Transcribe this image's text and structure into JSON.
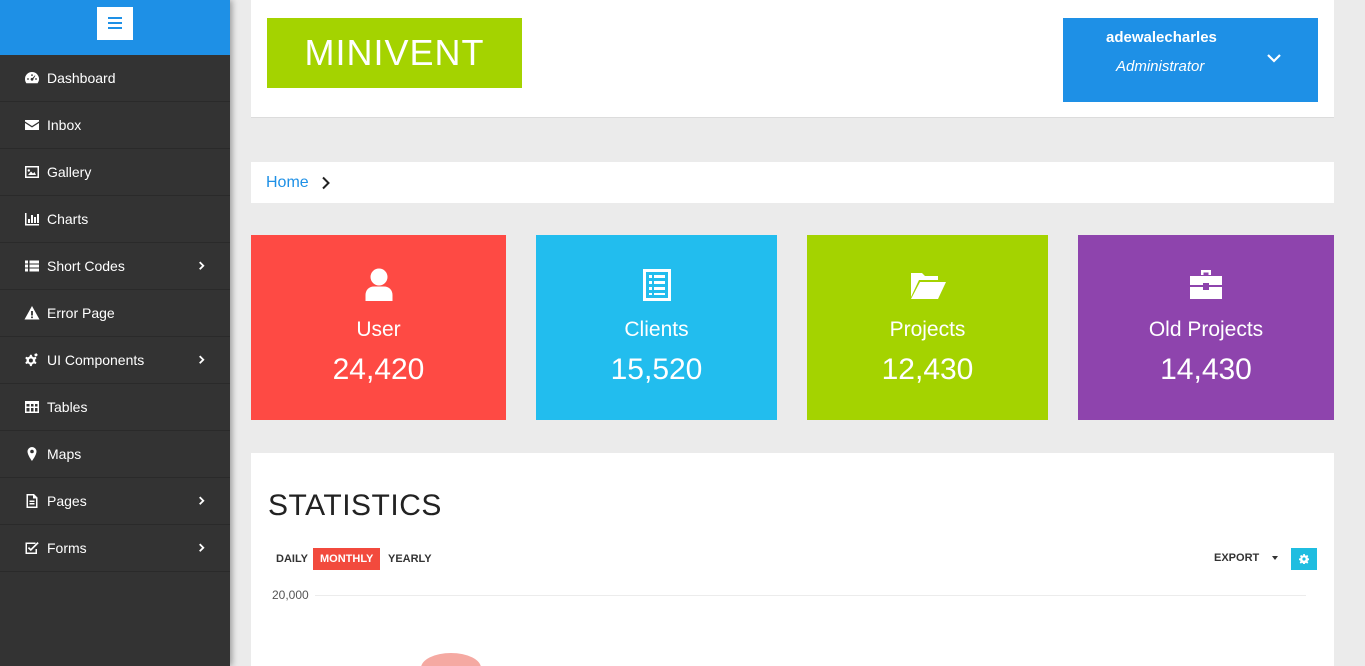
{
  "sidebar": {
    "menu_icon": "hamburger-menu-icon",
    "items": [
      {
        "label": "Dashboard",
        "icon": "dashboard-icon",
        "has_submenu": false
      },
      {
        "label": "Inbox",
        "icon": "envelope-icon",
        "has_submenu": false
      },
      {
        "label": "Gallery",
        "icon": "image-icon",
        "has_submenu": false
      },
      {
        "label": "Charts",
        "icon": "bar-chart-icon",
        "has_submenu": false
      },
      {
        "label": "Short Codes",
        "icon": "list-icon",
        "has_submenu": true
      },
      {
        "label": "Error Page",
        "icon": "warning-icon",
        "has_submenu": false
      },
      {
        "label": "UI Components",
        "icon": "cogs-icon",
        "has_submenu": true
      },
      {
        "label": "Tables",
        "icon": "table-icon",
        "has_submenu": false
      },
      {
        "label": "Maps",
        "icon": "map-marker-icon",
        "has_submenu": false
      },
      {
        "label": "Pages",
        "icon": "file-icon",
        "has_submenu": true
      },
      {
        "label": "Forms",
        "icon": "checkbox-icon",
        "has_submenu": true
      }
    ]
  },
  "header": {
    "logo_text": "MINIVENT",
    "user": {
      "name": "adewalecharles",
      "role": "Administrator"
    }
  },
  "breadcrumb": {
    "home": "Home"
  },
  "cards": [
    {
      "label": "User",
      "value": "24,420",
      "icon": "user-icon",
      "color": "#fe4a44"
    },
    {
      "label": "Clients",
      "value": "15,520",
      "icon": "list-alt-icon",
      "color": "#22bdee"
    },
    {
      "label": "Projects",
      "value": "12,430",
      "icon": "folder-open-icon",
      "color": "#a4d300"
    },
    {
      "label": "Old Projects",
      "value": "14,430",
      "icon": "briefcase-icon",
      "color": "#8e44ad"
    }
  ],
  "statistics": {
    "title": "STATISTICS",
    "periods": [
      "DAILY",
      "MONTHLY",
      "YEARLY"
    ],
    "active_period": "MONTHLY",
    "export_label": "EXPORT",
    "y_tick": "20,000"
  },
  "colors": {
    "accent_blue": "#1e90e6",
    "sidebar_bg": "#333333",
    "logo_green": "#a4d300",
    "active_red": "#f24a3d"
  }
}
